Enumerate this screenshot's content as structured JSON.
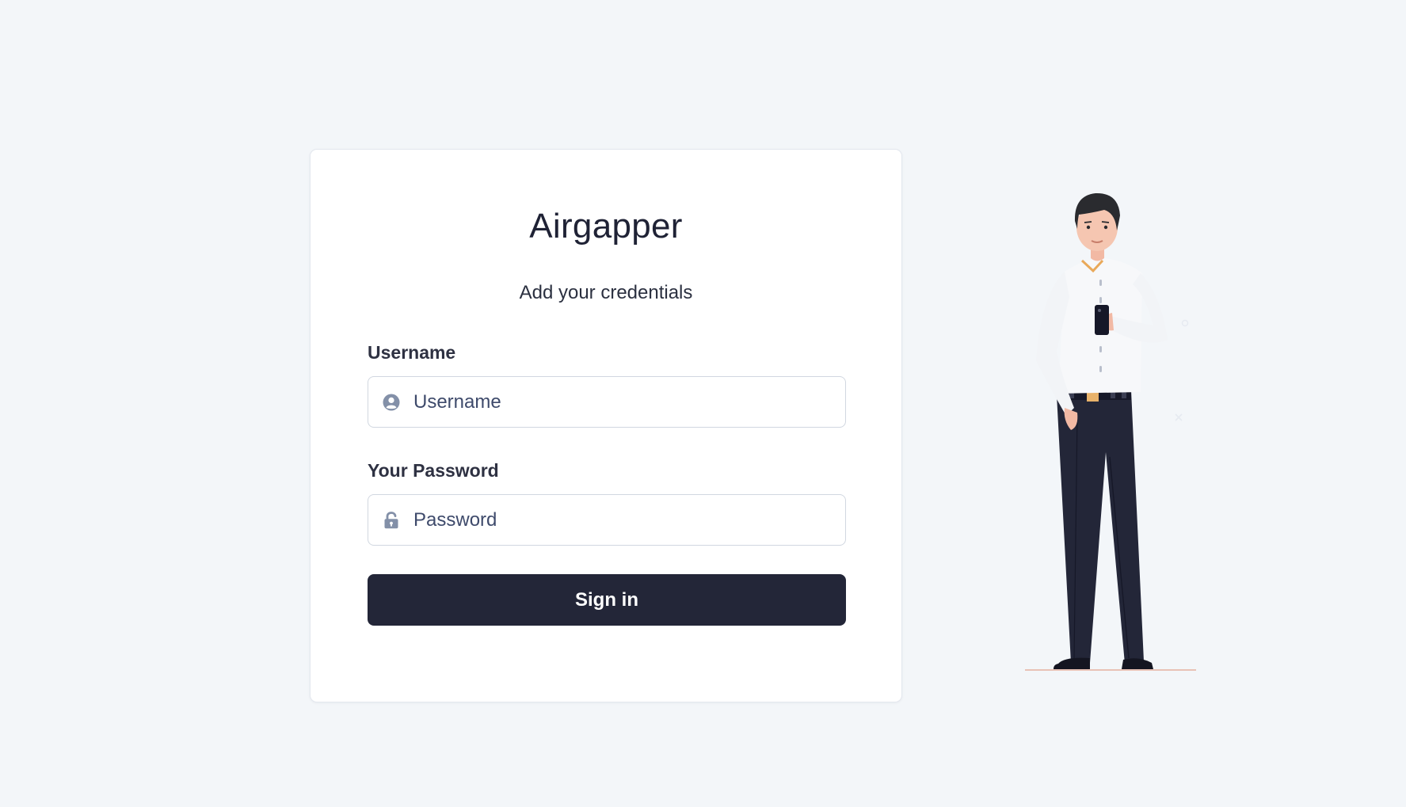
{
  "app": {
    "title": "Airgapper",
    "subtitle": "Add your credentials"
  },
  "form": {
    "username": {
      "label": "Username",
      "placeholder": "Username",
      "value": "",
      "icon": "user-circle-icon"
    },
    "password": {
      "label": "Your Password",
      "placeholder": "Password",
      "value": "",
      "icon": "unlock-icon"
    },
    "submit_label": "Sign in"
  },
  "colors": {
    "page_background": "#f3f6f9",
    "card_background": "#ffffff",
    "button": "#232638",
    "icon": "#8390a8",
    "text": "#1f2235"
  }
}
